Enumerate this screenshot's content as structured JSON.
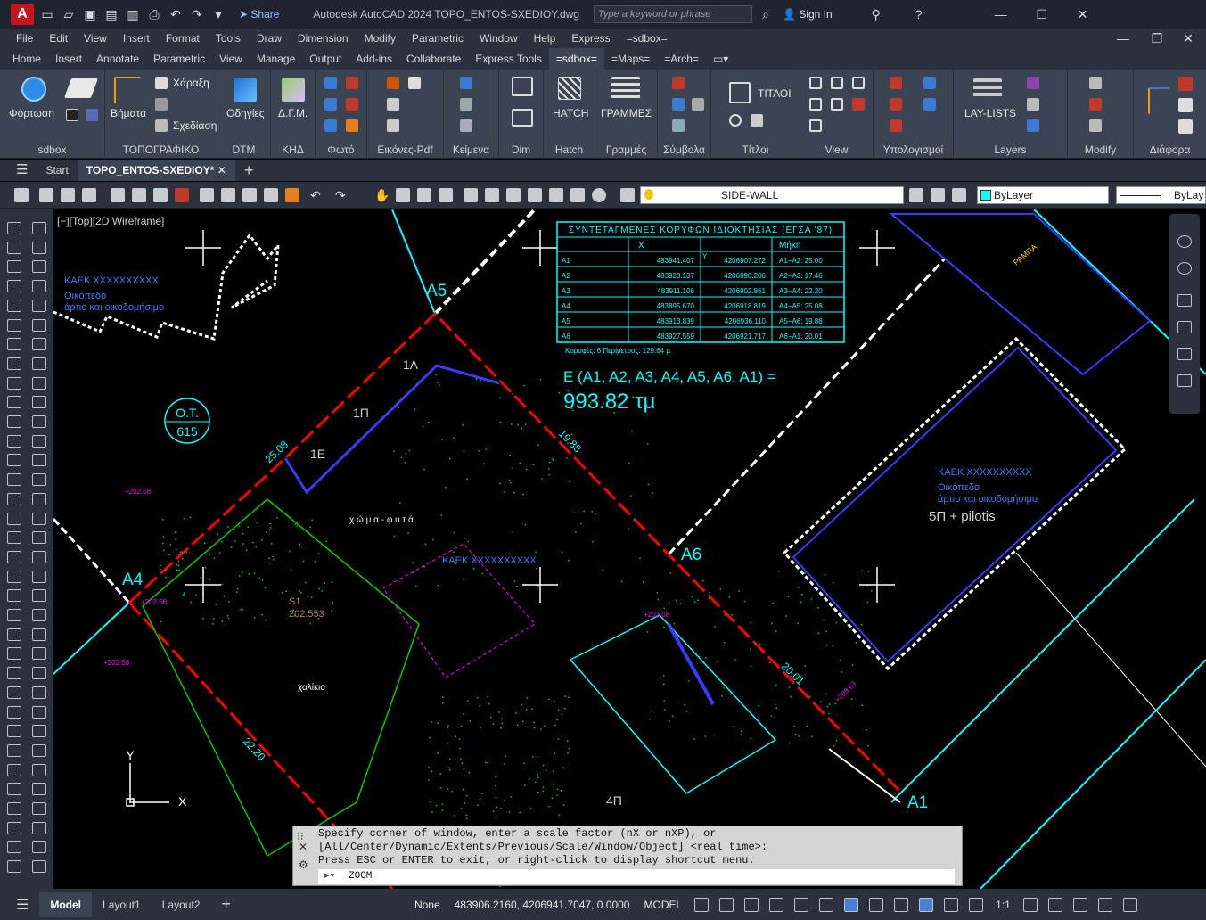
{
  "titlebar": {
    "logo": "A",
    "share_label": "Share",
    "app_title": "Autodesk AutoCAD 2024   TOPO_ENTOS-SXEDIOY.dwg",
    "search_placeholder": "Type a keyword or phrase",
    "signin_label": "Sign In"
  },
  "menubar": [
    "File",
    "Edit",
    "View",
    "Insert",
    "Format",
    "Tools",
    "Draw",
    "Dimension",
    "Modify",
    "Parametric",
    "Window",
    "Help",
    "Express",
    "=sdbox="
  ],
  "ribbon_tabs": [
    "Home",
    "Insert",
    "Annotate",
    "Parametric",
    "View",
    "Manage",
    "Output",
    "Add-ins",
    "Collaborate",
    "Express Tools",
    "=sdbox=",
    "=Maps=",
    "=Arch="
  ],
  "active_ribbon_tab": "=sdbox=",
  "ribbon": {
    "panels": [
      "sdbox",
      "ΤΟΠΟΓΡΑΦΙΚΟ",
      "DTM",
      "ΚΗΔ",
      "Φωτό",
      "Εικόνες-Pdf",
      "Κείμενα",
      "Dim",
      "Hatch",
      "Γραμμές",
      "Σύμβολα",
      "Τίτλοι",
      "View",
      "Υπολογισμοί",
      "Layers",
      "Modify",
      "Διάφορα"
    ],
    "labels": {
      "fortosi": "Φόρτωση",
      "vimata": "Βήματα",
      "xaraxi": "Χάραξη",
      "sxediasi": "Σχεδίαση",
      "odigies": "Οδηγίες",
      "dgm": "Δ.Γ.Μ.",
      "hatch": "HATCH",
      "grammes": "ΓΡΑΜΜΕΣ",
      "titloi": "ΤΙΤΛΟΙ",
      "laylists": "LAY-LISTS"
    }
  },
  "filetabs": {
    "start": "Start",
    "active": "TOPO_ENTOS-SXEDIOY*"
  },
  "toolbar": {
    "layer": "SIDE-WALL",
    "color": "ByLayer",
    "linetype": "ByLay"
  },
  "canvas": {
    "view_label": "[−][Top][2D Wireframe]",
    "table": {
      "title": "ΣΥΝΤΕΤΑΓΜΕΝΕΣ ΚΟΡΥΦΩΝ ΙΔΙΟΚΤΗΣΙΑΣ (ΕΓΣΑ '87)",
      "headers": [
        "X",
        "Y",
        "Μήκη"
      ],
      "rows": [
        [
          "A1",
          "483941.407",
          "4206907.272",
          "A1−A2: 25.00"
        ],
        [
          "A2",
          "483923.137",
          "4206890.206",
          "A2−A3: 17.46"
        ],
        [
          "A3",
          "483911.106",
          "4206902.861",
          "A3−A4: 22.20"
        ],
        [
          "A4",
          "483895.670",
          "4206918.819",
          "A4−A5: 25.08"
        ],
        [
          "A5",
          "483913.839",
          "4206936.110",
          "A5−A6: 19.88"
        ],
        [
          "A6",
          "483927.559",
          "4206921.717",
          "A6−A1: 20.01"
        ]
      ],
      "footer": "Κορυφές:  6     Περίμετρος:  129.64 μ."
    },
    "area_formula": "E (A1, A2, A3, A4, A5, A6, A1) =",
    "area_value": "993.82 τμ",
    "ot_label": "Ο.Τ.",
    "ot_number": "615",
    "kaek_left": "ΚΑΕΚ ΧΧΧΧΧΧΧΧΧΧ",
    "kaek_left_line1": "Οικόπεδο",
    "kaek_left_line2": "άρτιο και οικοδομήσιμο",
    "kaek_right": "ΚΑΕΚ ΧΧΧΧΧΧΧΧΧΧ",
    "kaek_right_line1": "Οικόπεδο",
    "kaek_right_line2": "άρτιο και οικοδομήσιμο",
    "kaek_center": "ΚΑΕΚ ΧΧΧΧΧΧΧΧΧΧ",
    "building_right": "5Π + pilotis",
    "vertex_labels": [
      "A5",
      "A4",
      "A6",
      "A1"
    ],
    "floor_labels": [
      "1Λ",
      "1Π",
      "1Ε",
      "4Π"
    ],
    "dims": [
      "25.08",
      "19.88",
      "22.20",
      "20.01"
    ],
    "text_xoma_fyta": "χ ώ μ α  -  φ υ τ ά",
    "text_xaliki": "χαλίκιο",
    "text_rampa": "ΡΑΜΠΑ",
    "s1_label": "S1",
    "s1_value": "202.553",
    "elev_labels": [
      "+202.08",
      "+202.58",
      "+202.58",
      "+205.63",
      "+203.08"
    ]
  },
  "command": {
    "history": "Specify corner of window, enter a scale factor (nX or nXP), or\n[All/Center/Dynamic/Extents/Previous/Scale/Window/Object] <real time>:\nPress ESC or ENTER to exit, or right-click to display shortcut menu.",
    "input": "ZOOM"
  },
  "statusbar": {
    "model_tab": "Model",
    "layout1": "Layout1",
    "layout2": "Layout2",
    "none": "None",
    "coords": "483906.2160, 4206941.7047, 0.0000",
    "model": "MODEL",
    "scale": "1:1"
  },
  "colors": {
    "accent": "#00ffff",
    "property_line": "#ff0000",
    "wall": "#ffffff",
    "vegetation": "#00ff00",
    "magenta": "#ff00ff",
    "table": "#00ffff"
  }
}
